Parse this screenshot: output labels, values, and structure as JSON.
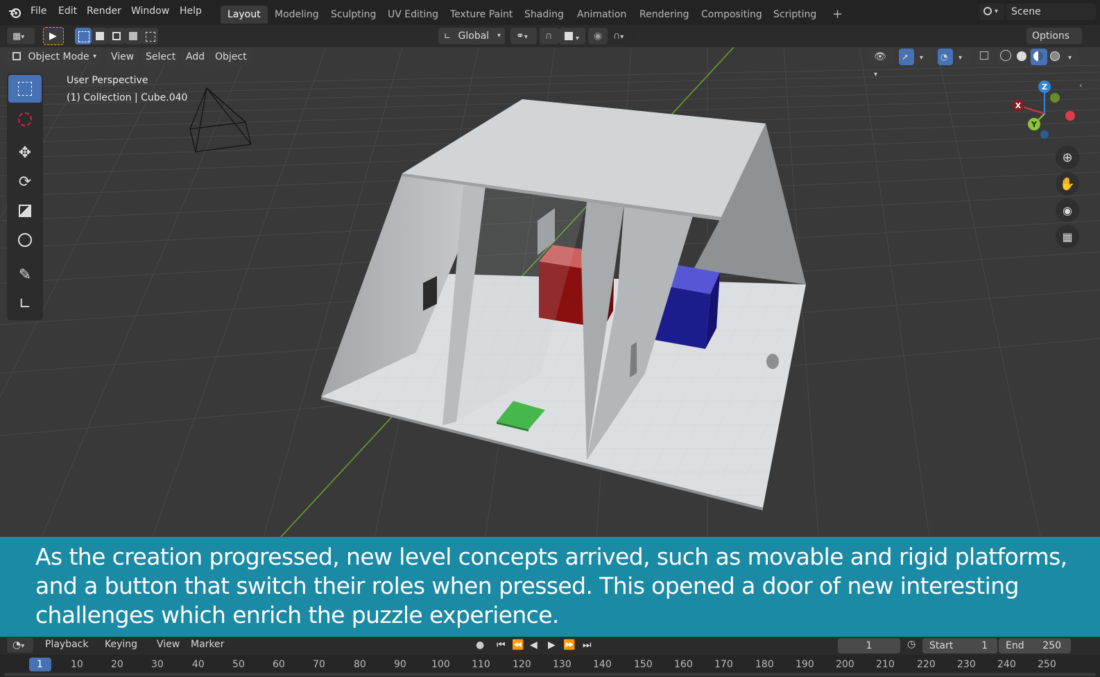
{
  "menubar": {
    "app_icon": "blender-logo-icon",
    "menus": [
      "File",
      "Edit",
      "Render",
      "Window",
      "Help"
    ],
    "workspace_tabs": [
      "Layout",
      "Modeling",
      "Sculpting",
      "UV Editing",
      "Texture Paint",
      "Shading",
      "Animation",
      "Rendering",
      "Compositing",
      "Scripting"
    ],
    "active_tab": "Layout",
    "add_tab": "+",
    "scene_label": "Scene"
  },
  "header": {
    "orientation": "Global",
    "options_label": "Options"
  },
  "viewport_header": {
    "mode": "Object Mode",
    "menus": [
      "View",
      "Select",
      "Add",
      "Object"
    ]
  },
  "viewport": {
    "view_name": "User Perspective",
    "collection_info": "(1) Collection | Cube.040",
    "gizmo_axes": [
      "Z",
      "X",
      "Y"
    ],
    "colors": {
      "red_cube": "#8a1010",
      "blue_cube": "#1a1a8a",
      "green_button": "#46b74b",
      "axis_x": "#d9383a",
      "axis_y": "#8cc43a",
      "axis_z": "#2f86d8"
    }
  },
  "caption": {
    "text": "As the creation progressed, new level concepts arrived, such as movable and rigid platforms, and a button that switch their roles when pressed. This opened a door of new interesting challenges which enrich the puzzle experience."
  },
  "timeline": {
    "menus": [
      "Playback",
      "Keying",
      "View",
      "Marker"
    ],
    "current_frame": "1",
    "start_label": "Start",
    "start_value": "1",
    "end_label": "End",
    "end_value": "250",
    "ticks": [
      "1",
      "10",
      "20",
      "30",
      "40",
      "50",
      "60",
      "70",
      "80",
      "90",
      "100",
      "110",
      "120",
      "130",
      "140",
      "150",
      "160",
      "170",
      "180",
      "190",
      "200",
      "210",
      "220",
      "230",
      "240",
      "250"
    ]
  }
}
